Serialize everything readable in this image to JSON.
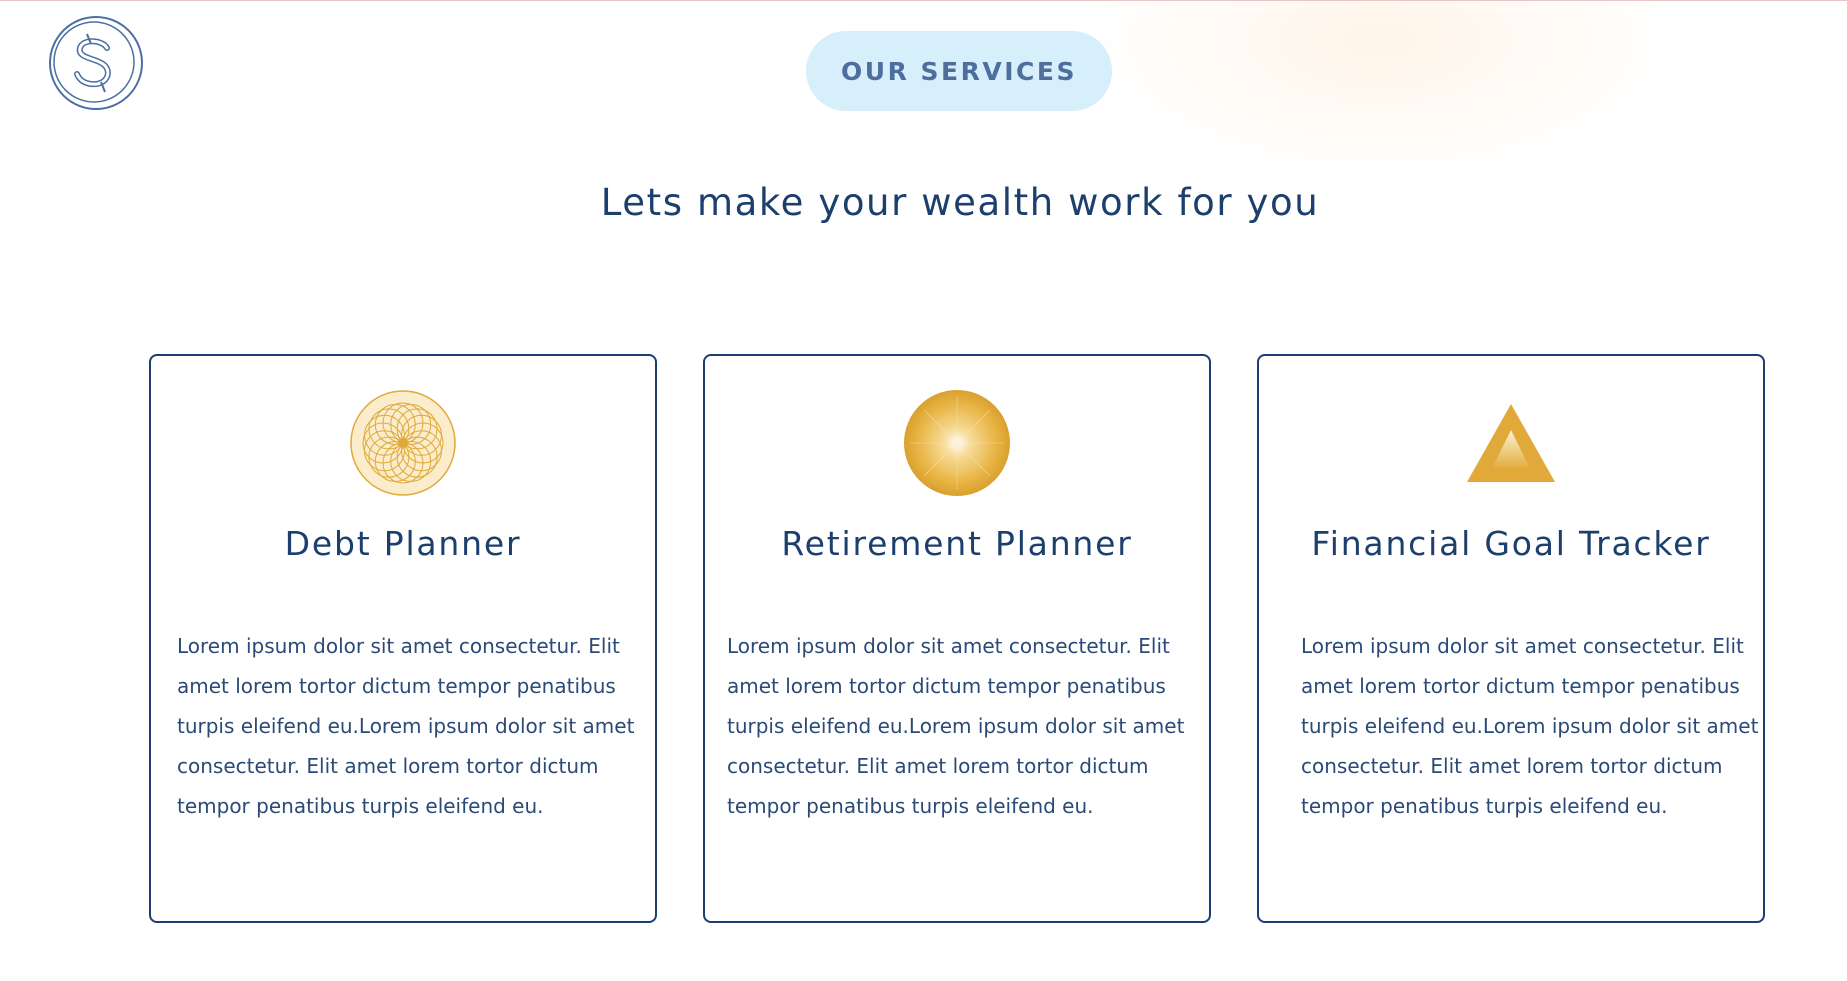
{
  "header": {
    "logo_icon": "dollar-coin-logo-icon",
    "badge_label": "OUR SERVICES",
    "badge_color": "#d7eefb"
  },
  "hero": {
    "headline": "Lets make your wealth work for you"
  },
  "cards": [
    {
      "icon": "spirograph-circle-icon",
      "title": "Debt Planner",
      "body": "Lorem ipsum dolor sit amet consectetur. Elit amet lorem tortor dictum tempor penatibus turpis eleifend eu.Lorem ipsum dolor sit amet consectetur. Elit amet lorem tortor dictum tempor penatibus turpis eleifend eu."
    },
    {
      "icon": "golden-sphere-icon",
      "title": "Retirement Planner",
      "body": "Lorem ipsum dolor sit amet consectetur. Elit amet lorem tortor dictum tempor penatibus turpis eleifend eu.Lorem ipsum dolor sit amet consectetur. Elit amet lorem tortor dictum tempor penatibus turpis eleifend eu."
    },
    {
      "icon": "golden-triangle-icon",
      "title": "Financial Goal Tracker",
      "body": "Lorem ipsum dolor sit amet consectetur. Elit amet lorem tortor dictum tempor penatibus turpis eleifend eu.Lorem ipsum dolor sit amet consectetur. Elit amet lorem tortor dictum tempor penatibus turpis eleifend eu."
    }
  ],
  "colors": {
    "primary_navy": "#1d3f6e",
    "card_border": "#1d3c72",
    "accent_gold": "#e0a93a"
  }
}
